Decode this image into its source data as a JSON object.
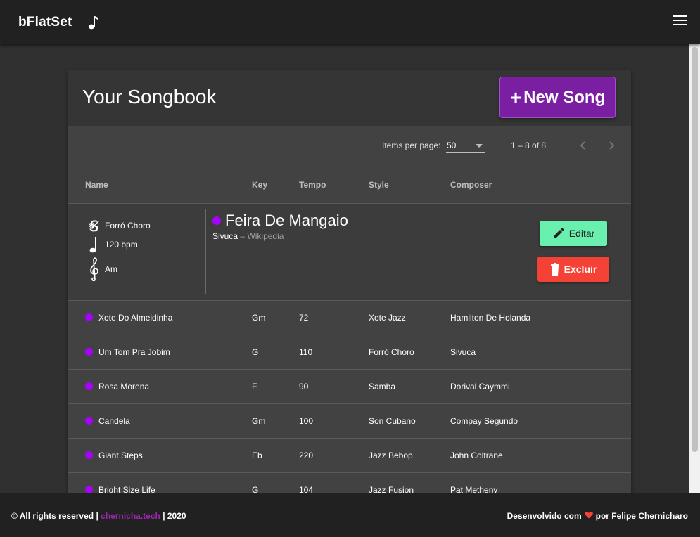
{
  "app": {
    "brand": "bFlatSet"
  },
  "card": {
    "title": "Your Songbook",
    "new_song_label": "New Song",
    "new_song_plus": "+"
  },
  "paginator": {
    "items_per_page_label": "Items per page:",
    "items_per_page_value": "50",
    "range_label": "1 – 8 of 8"
  },
  "table": {
    "headers": {
      "name": "Name",
      "key": "Key",
      "tempo": "Tempo",
      "style": "Style",
      "composer": "Composer"
    },
    "expanded": {
      "style": "Forró Choro",
      "tempo": "120 bpm",
      "key": "Am",
      "title": "Feira De Mangaio",
      "composer": "Sivuca",
      "separator": "–",
      "link_label": "Wikipedia",
      "edit_label": "Editar",
      "delete_label": "Excluir"
    },
    "rows": [
      {
        "name": "Xote Do Almeidinha",
        "key": "Gm",
        "tempo": "72",
        "style": "Xote Jazz",
        "composer": "Hamilton De Holanda"
      },
      {
        "name": "Um Tom Pra Jobim",
        "key": "G",
        "tempo": "110",
        "style": "Forró Choro",
        "composer": "Sivuca"
      },
      {
        "name": "Rosa Morena",
        "key": "F",
        "tempo": "90",
        "style": "Samba",
        "composer": "Dorival Caymmi"
      },
      {
        "name": "Candela",
        "key": "Gm",
        "tempo": "100",
        "style": "Son Cubano",
        "composer": "Compay Segundo"
      },
      {
        "name": "Giant Steps",
        "key": "Eb",
        "tempo": "220",
        "style": "Jazz Bebop",
        "composer": "John Coltrane"
      },
      {
        "name": "Bright Size Life",
        "key": "G",
        "tempo": "104",
        "style": "Jazz Fusion",
        "composer": "Pat Metheny"
      }
    ]
  },
  "footer": {
    "rights_prefix": "© All rights reserved |",
    "site_link": "chernicha.tech",
    "year_suffix": "| 2020",
    "dev_prefix": "Desenvolvido com",
    "dev_suffix": "por Felipe Chernicharo"
  },
  "colors": {
    "accent": "#7b1fa2",
    "dot": "#aa00ff",
    "edit": "#69f0ae",
    "delete": "#f44336",
    "heart": "#f44336"
  },
  "icons": [
    "music-note-icon",
    "menu-icon",
    "chevron-left-icon",
    "chevron-right-icon",
    "segno-icon",
    "quarter-note-icon",
    "treble-clef-icon",
    "pencil-icon",
    "trash-icon",
    "heart-icon"
  ]
}
